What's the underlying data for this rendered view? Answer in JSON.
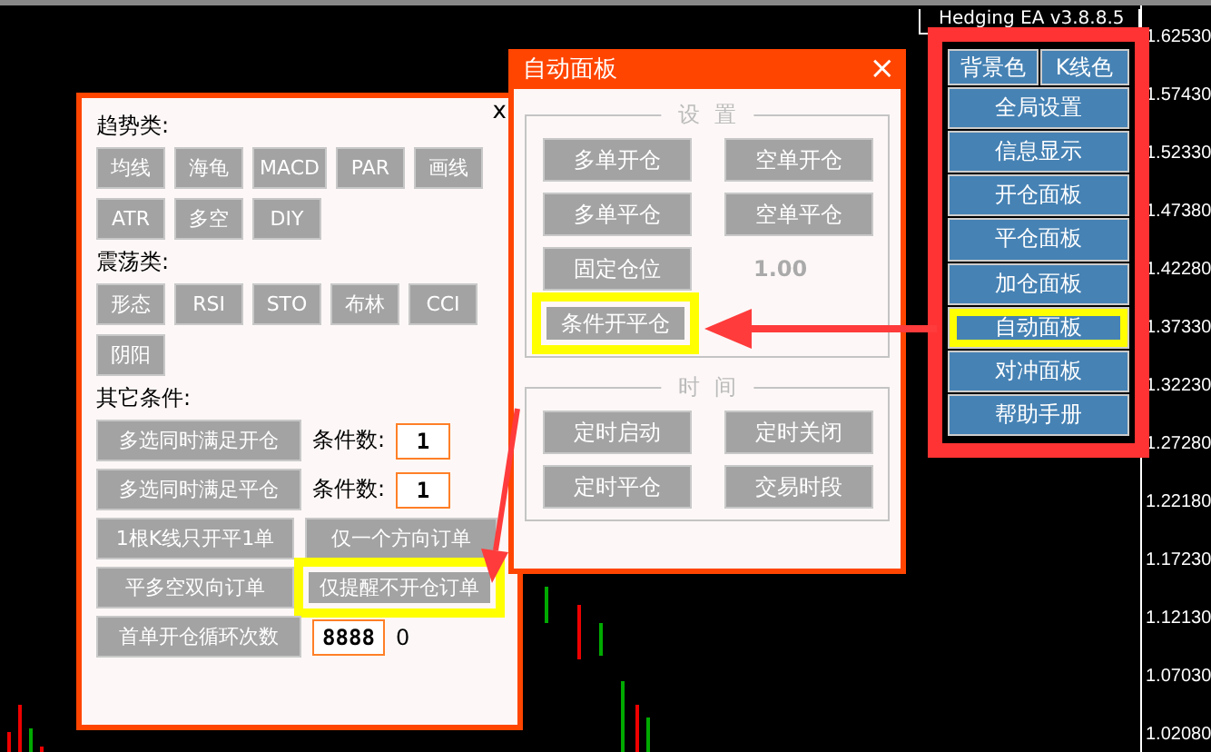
{
  "chart": {
    "title": "Hedging EA v3.8.8.5",
    "price_labels": [
      "1.62530",
      "1.57430",
      "1.52330",
      "1.47380",
      "1.42280",
      "1.37330",
      "1.32230",
      "1.27280",
      "1.22180",
      "1.17230",
      "1.12130",
      "1.07030",
      "1.02080"
    ]
  },
  "condition_panel": {
    "close": "x",
    "sections": [
      {
        "heading": "趋势类:",
        "buttons": [
          {
            "label": "均线"
          },
          {
            "label": "海龟"
          },
          {
            "label": "MACD"
          },
          {
            "label": "PAR"
          },
          {
            "label": "画线"
          },
          {
            "label": "ATR"
          },
          {
            "label": "多空"
          },
          {
            "label": "DIY"
          }
        ]
      },
      {
        "heading": "震荡类:",
        "buttons": [
          {
            "label": "形态"
          },
          {
            "label": "RSI"
          },
          {
            "label": "STO"
          },
          {
            "label": "布林"
          },
          {
            "label": "CCI"
          },
          {
            "label": "阴阳"
          }
        ]
      }
    ],
    "other_heading": "其它条件:",
    "rows": [
      {
        "kind": "count",
        "button": "多选同时满足开仓",
        "label": "条件数:",
        "value": "1"
      },
      {
        "kind": "count",
        "button": "多选同时满足平仓",
        "label": "条件数:",
        "value": "1"
      },
      {
        "kind": "pair",
        "buttons": [
          {
            "label": "1根K线只开平1单",
            "highlighted": false
          },
          {
            "label": "仅一个方向订单",
            "highlighted": false
          }
        ]
      },
      {
        "kind": "pair",
        "buttons": [
          {
            "label": "平多空双向订单",
            "highlighted": false
          },
          {
            "label": "仅提醒不开仓订单",
            "highlighted": true
          }
        ]
      },
      {
        "kind": "loop",
        "button": "首单开仓循环次数",
        "value": "8888",
        "note": "0"
      }
    ]
  },
  "auto_panel": {
    "title": "自动面板",
    "close": "×",
    "groups": [
      {
        "legend": "设  置",
        "items": [
          {
            "kind": "button",
            "label": "多单开仓",
            "highlighted": false
          },
          {
            "kind": "button",
            "label": "空单开仓",
            "highlighted": false
          },
          {
            "kind": "button",
            "label": "多单平仓",
            "highlighted": false
          },
          {
            "kind": "button",
            "label": "空单平仓",
            "highlighted": false
          },
          {
            "kind": "button",
            "label": "固定仓位",
            "highlighted": false
          },
          {
            "kind": "value",
            "label": "1.00"
          },
          {
            "kind": "button",
            "label": "条件开平仓",
            "highlighted": true
          }
        ]
      },
      {
        "legend": "时  间",
        "items": [
          {
            "kind": "button",
            "label": "定时启动",
            "highlighted": false
          },
          {
            "kind": "button",
            "label": "定时关闭",
            "highlighted": false
          },
          {
            "kind": "button",
            "label": "定时平仓",
            "highlighted": false
          },
          {
            "kind": "button",
            "label": "交易时段",
            "highlighted": false
          }
        ]
      }
    ]
  },
  "menu": {
    "top": [
      "背景色",
      "K线色"
    ],
    "items": [
      {
        "label": "全局设置",
        "highlighted": false
      },
      {
        "label": "信息显示",
        "highlighted": false
      },
      {
        "label": "开仓面板",
        "highlighted": false
      },
      {
        "label": "平仓面板",
        "highlighted": false
      },
      {
        "label": "加仓面板",
        "highlighted": false
      },
      {
        "label": "自动面板",
        "highlighted": true
      },
      {
        "label": "对冲面板",
        "highlighted": false
      },
      {
        "label": "帮助手册",
        "highlighted": false
      }
    ]
  }
}
